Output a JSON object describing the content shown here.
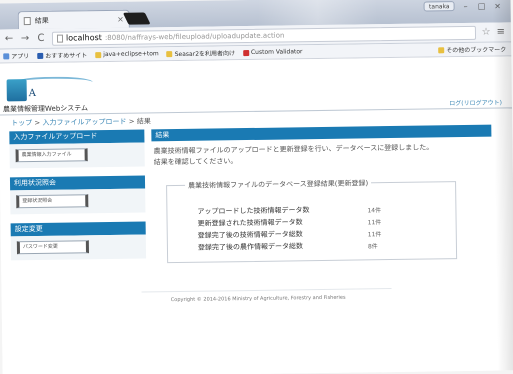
{
  "browser": {
    "tab_title": "結果",
    "tab_close": "×",
    "profile": "tanaka",
    "minimize": "–",
    "maximize": "□",
    "close": "×",
    "back": "←",
    "forward": "→",
    "reload": "C",
    "url_host": "localhost",
    "url_path": ":8080/naffrays-web/fileupload/uploadupdate.action",
    "star": "☆",
    "menu": "≡",
    "bookmarks": [
      {
        "label": "アプリ",
        "color": "#5a8fd8"
      },
      {
        "label": "おすすめサイト",
        "color": "#2a5db0"
      },
      {
        "label": "java+eclipse+tom",
        "color": "#e8c040"
      },
      {
        "label": "Seasar2を利用者向け",
        "color": "#e8c040"
      },
      {
        "label": "Custom Validator",
        "color": "#d03030"
      }
    ],
    "other_bookmarks": "その他のブックマーク"
  },
  "header": {
    "logo_text": "A",
    "system_title": "農業情報管理Webシステム",
    "logout": "ログ(リログアウト)"
  },
  "breadcrumb": {
    "top": "トップ",
    "sep1": " > ",
    "upload": "入力ファイルアップロード",
    "sep2": " > ",
    "current": "結果"
  },
  "sidebar": {
    "sections": [
      {
        "title": "入力ファイルアップロード",
        "button": "農業情報入力ファイル"
      },
      {
        "title": "利用状況照会",
        "button": "登録状況照会"
      },
      {
        "title": "設定変更",
        "button": "パスワード変更"
      }
    ]
  },
  "main": {
    "title": "結果",
    "message_line1": "農業技術情報ファイルのアップロードと更新登録を行い、データベースに登録しました。",
    "message_line2": "結果を確認してください。",
    "fieldset_legend": "農業技術情報ファイルのデータベース登録結果(更新登録)",
    "stats": [
      {
        "label": "アップロードした技術情報データ数",
        "value": "14件"
      },
      {
        "label": "更新登録された技術情報データ数",
        "value": "11件"
      },
      {
        "label": "登録完了後の技術情報データ総数",
        "value": "11件"
      },
      {
        "label": "登録完了後の農作情報データ総数",
        "value": "8件"
      }
    ]
  },
  "footer": {
    "copyright": "Copyright © 2014-2016 Ministry of Agriculture, Forestry and Fisheries"
  }
}
